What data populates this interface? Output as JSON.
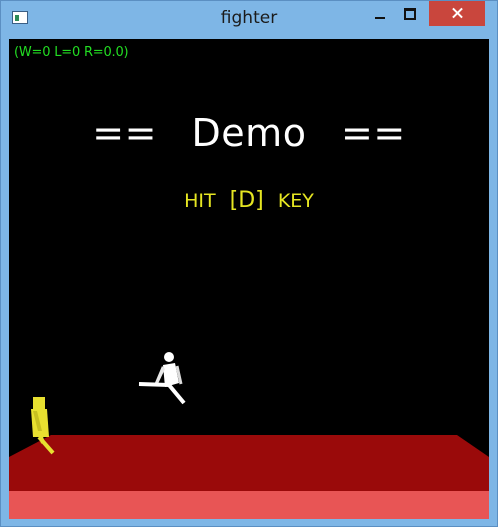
{
  "window": {
    "title": "fighter",
    "icon": "app-window-icon",
    "controls": [
      "minimize-icon",
      "maximize-icon",
      "close-icon"
    ],
    "close_color": "#c9463d",
    "frame_color": "#7eb6e6"
  },
  "hud": {
    "stats": "(W=0  L=0  R=0.0)",
    "stats_color": "#22dd22"
  },
  "banner": {
    "text": "==  Demo  ==",
    "color": "#ffffff"
  },
  "prompt": {
    "before": "HIT",
    "key": "[D]",
    "after": "KEY",
    "color": "#e6e622"
  },
  "scene": {
    "background": "#000000",
    "floor_top_color": "#9a0a0a",
    "floor_front_color": "#e85555",
    "fighters": [
      {
        "name": "white-fighter",
        "color": "#ffffff",
        "pose": "flying-kick"
      },
      {
        "name": "yellow-fighter",
        "color": "#e8e030",
        "pose": "standing"
      }
    ]
  }
}
